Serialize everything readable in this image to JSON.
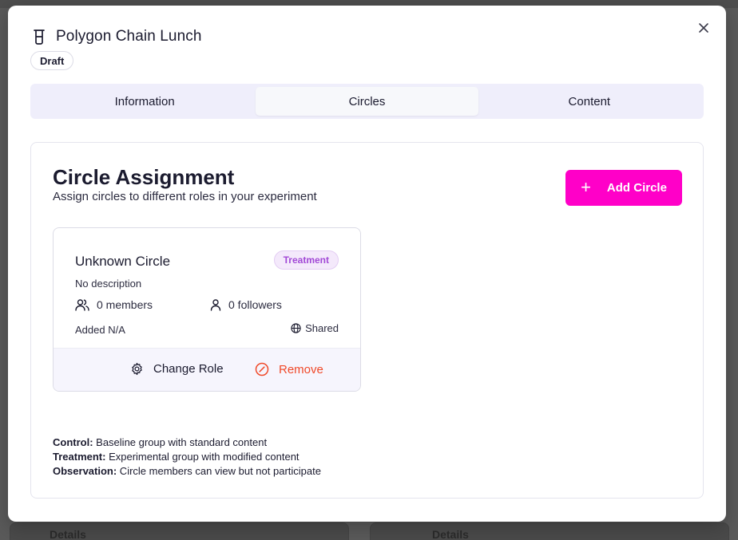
{
  "background": {
    "details_left": "Details",
    "details_right": "Details"
  },
  "modal": {
    "title": "Polygon Chain Lunch",
    "status_badge": "Draft",
    "close_icon": "close-icon",
    "title_icon": "beaker-icon"
  },
  "tabs": [
    {
      "label": "Information",
      "active": false
    },
    {
      "label": "Circles",
      "active": true
    },
    {
      "label": "Content",
      "active": false
    }
  ],
  "panel": {
    "title": "Circle Assignment",
    "subtitle": "Assign circles to different roles in your experiment",
    "add_button": "Add Circle"
  },
  "circle_card": {
    "name": "Unknown Circle",
    "role": "Treatment",
    "description": "No description",
    "members": "0 members",
    "followers": "0 followers",
    "added": "Added N/A",
    "visibility": "Shared",
    "change_role_label": "Change Role",
    "remove_label": "Remove"
  },
  "legend": [
    {
      "term": "Control:",
      "text": " Baseline group with standard content"
    },
    {
      "term": "Treatment:",
      "text": " Experimental group with modified content"
    },
    {
      "term": "Observation:",
      "text": " Circle members can view but not participate"
    }
  ],
  "colors": {
    "accent": "#ff00c8",
    "treatment_badge_text": "#a249d6",
    "treatment_badge_bg": "#f4e9fb",
    "remove_text": "#f04a2a",
    "tabs_bg": "#efeefb"
  }
}
